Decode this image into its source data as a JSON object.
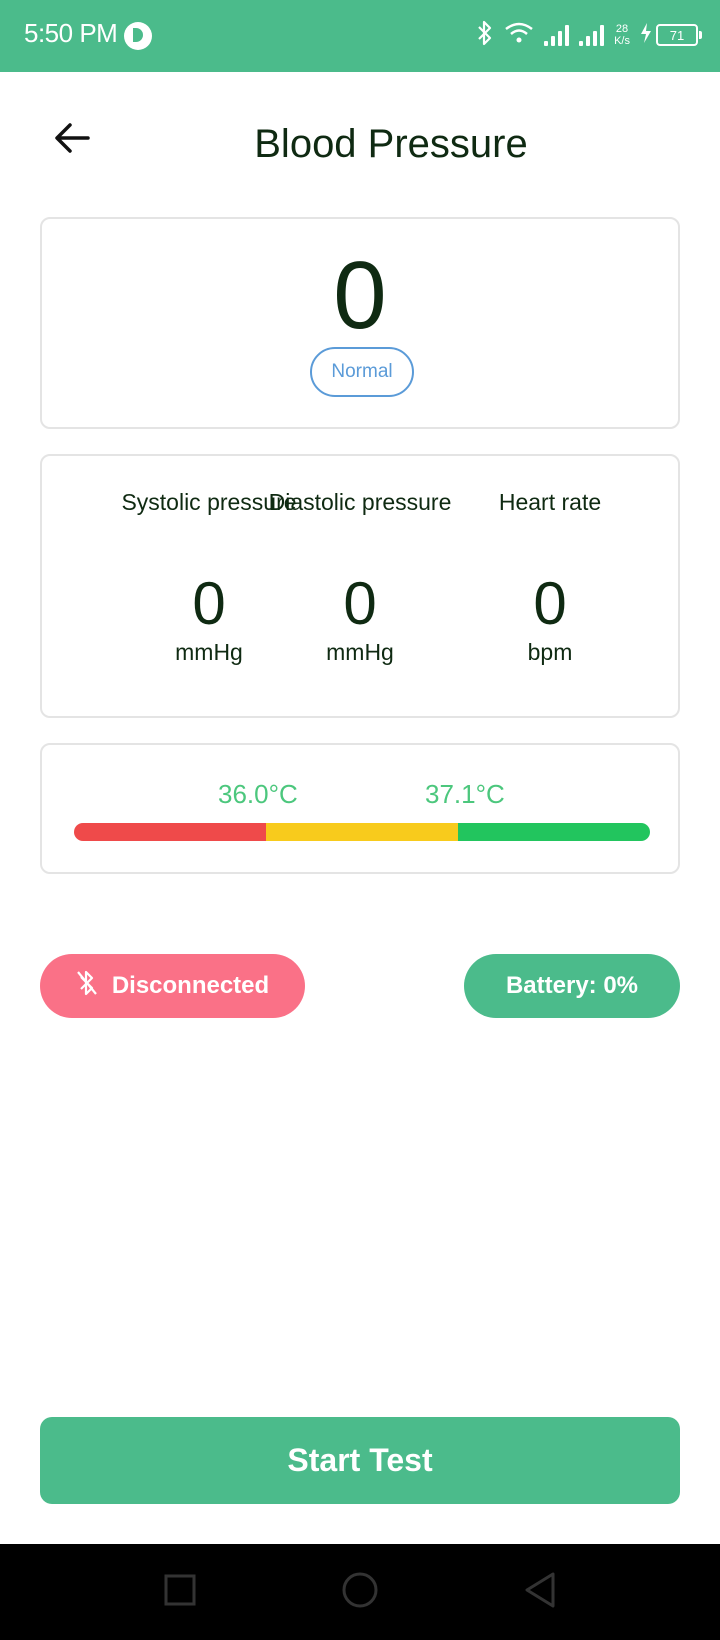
{
  "status_bar": {
    "time": "5:50 PM",
    "net_speed_value": "28",
    "net_speed_unit": "K/s",
    "battery_level": "71"
  },
  "header": {
    "title": "Blood Pressure",
    "back_icon": "arrow-left-icon"
  },
  "summary": {
    "value": "0",
    "status": "Normal",
    "status_color": "#5b9bd8"
  },
  "metrics": [
    {
      "label": "Systolic pressure",
      "value": "0",
      "unit": "mmHg"
    },
    {
      "label": "Diastolic pressure",
      "value": "0",
      "unit": "mmHg"
    },
    {
      "label": "Heart rate",
      "value": "0",
      "unit": "bpm"
    }
  ],
  "range": {
    "low_label": "36.0°C",
    "high_label": "37.1°C",
    "label_color": "#4cc77d",
    "segments": [
      {
        "name": "low",
        "color": "#ef4a4a"
      },
      {
        "name": "mid",
        "color": "#f8cb1c"
      },
      {
        "name": "high",
        "color": "#22c55e"
      }
    ]
  },
  "connection": {
    "label": "Disconnected",
    "icon": "bluetooth-off-icon",
    "color": "#fa7187"
  },
  "battery": {
    "label": "Battery: 0%",
    "color": "#4bbb8b"
  },
  "actions": {
    "start_label": "Start Test"
  },
  "nav": {
    "icons": [
      "square-icon",
      "circle-icon",
      "triangle-back-icon"
    ]
  }
}
